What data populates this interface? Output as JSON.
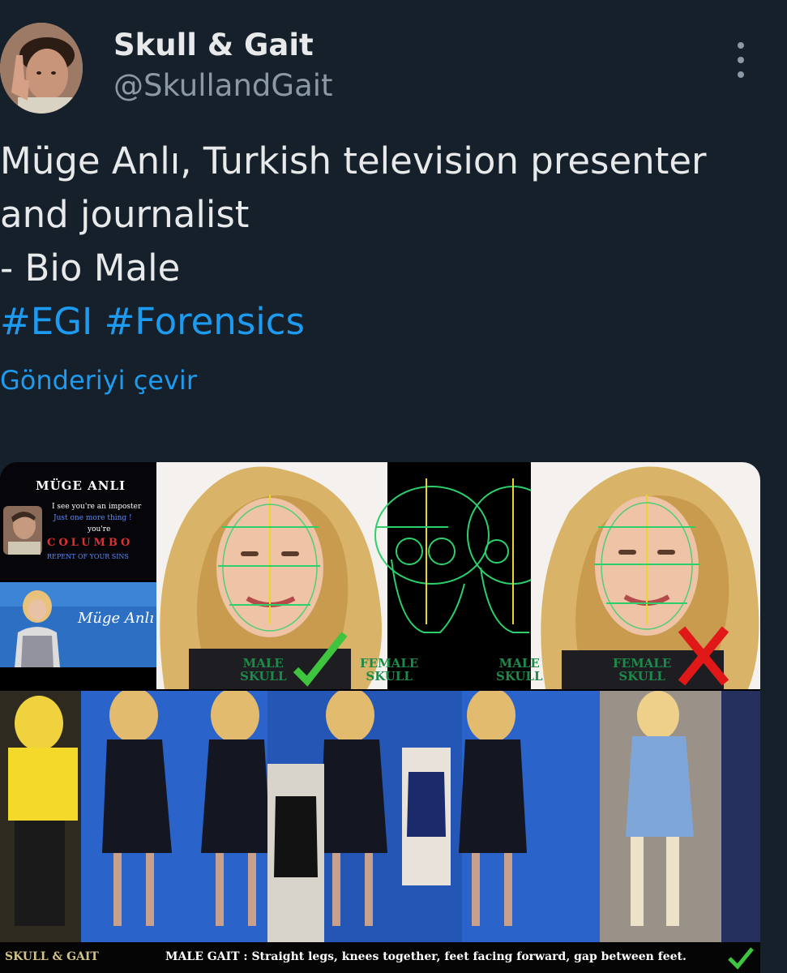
{
  "author": {
    "display_name": "Skull & Gait",
    "handle": "@SkullandGait",
    "avatar_icon": "avatar-photo"
  },
  "tweet": {
    "text_lines": [
      "Müge Anlı, Turkish television presenter",
      "and journalist",
      "- Bio Male"
    ],
    "hashtags": [
      "#EGI",
      "#Forensics"
    ],
    "translate_label": "Gönderiyi çevir"
  },
  "more_icon": "more-vertical-icon",
  "media": {
    "title": "MÜGE ANLI",
    "quote_lines": [
      "I see you're an imposter",
      "Just one more thing !",
      "you're"
    ],
    "columbo": "COLUMBO",
    "repent": "REPENT OF YOUR SINS",
    "signature": "Müge Anlı",
    "panels": [
      {
        "label_line1": "MALE",
        "label_line2": "SKULL",
        "verdict": "check"
      },
      {
        "label_line1": "FEMALE",
        "label_line2": "SKULL",
        "verdict": "none"
      },
      {
        "label_line1": "MALE",
        "label_line2": "SKULL",
        "verdict": "none"
      },
      {
        "label_line1": "FEMALE",
        "label_line2": "SKULL",
        "verdict": "cross"
      }
    ],
    "brand_caption": "SKULL & GAIT",
    "gait_caption": "MALE GAIT : Straight legs, knees together, feet facing forward, gap between feet.",
    "colors": {
      "check": "#3ec43e",
      "cross": "#e01818",
      "grid_yellow": "#e8d62a",
      "grid_green": "#2bd06a"
    }
  }
}
